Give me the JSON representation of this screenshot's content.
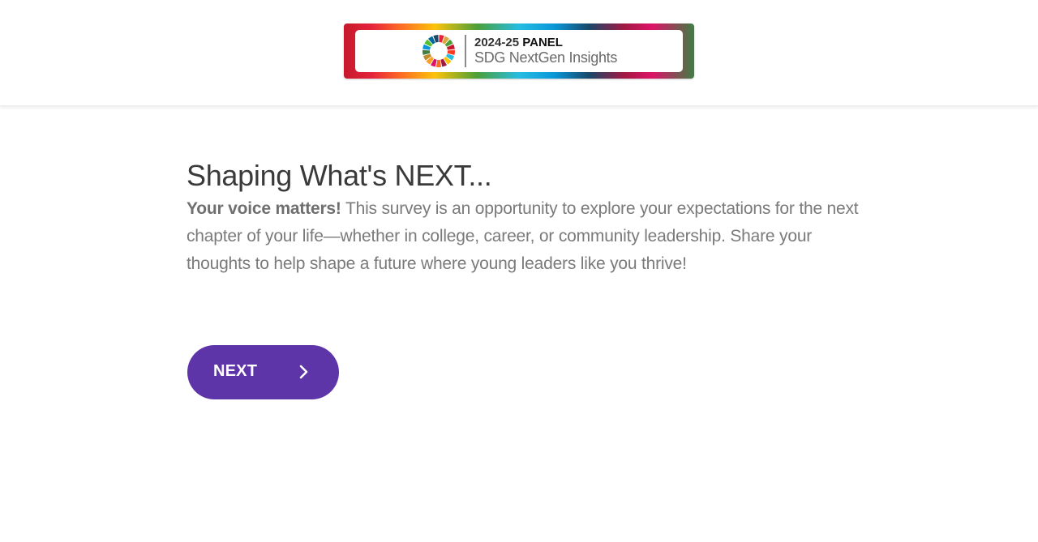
{
  "header": {
    "logo": {
      "line1_year": "2024-25",
      "line1_panel": "PANEL",
      "line2": "SDG NextGen Insights",
      "icon": "sdg-wheel-icon"
    }
  },
  "main": {
    "title": "Shaping What's NEXT...",
    "intro_bold": "Your voice matters!",
    "intro_text": " This survey is an opportunity to explore your expectations for the next chapter of your life—whether in college, career, or community leadership. Share your thoughts to help shape a future where young leaders like you thrive!"
  },
  "actions": {
    "next_label": "NEXT",
    "next_icon": "chevron-right-icon"
  },
  "colors": {
    "primary_button": "#5e35a8",
    "title_text": "#3a3a3a",
    "body_text": "#7a7a7a"
  }
}
